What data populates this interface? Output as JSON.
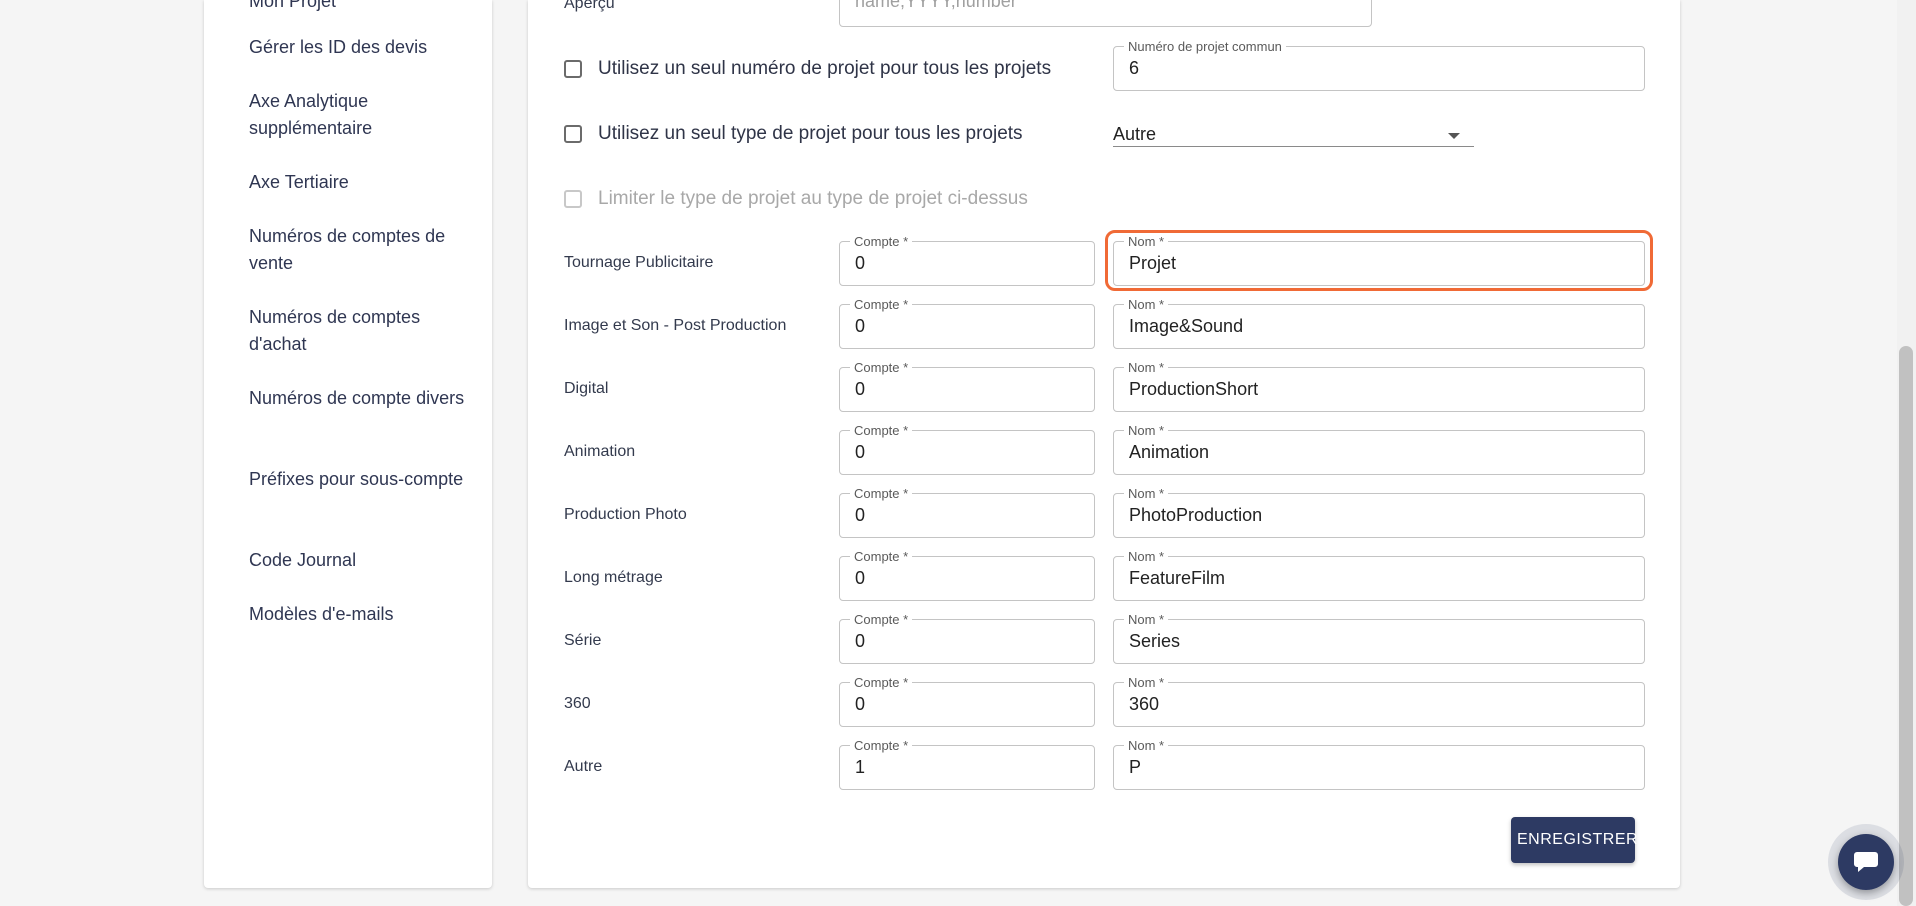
{
  "sidebar": {
    "items": [
      {
        "id": "partial",
        "label": "Mon Projet"
      },
      {
        "id": "quote-ids",
        "label": "Gérer les ID des devis"
      },
      {
        "id": "extra-axis",
        "label": "Axe Analytique supplémentaire"
      },
      {
        "id": "tertiary-axis",
        "label": "Axe Tertiaire"
      },
      {
        "id": "sales-accounts",
        "label": "Numéros de comptes de vente"
      },
      {
        "id": "purchase-accounts",
        "label": "Numéros de comptes d'achat"
      },
      {
        "id": "misc-accounts",
        "label": "Numéros de compte divers"
      },
      {
        "id": "subaccount-prefixes",
        "label": "Préfixes pour sous-compte"
      },
      {
        "id": "journal-code",
        "label": "Code Journal"
      },
      {
        "id": "email-templates",
        "label": "Modèles d'e-mails"
      }
    ]
  },
  "preview": {
    "label": "Aperçu",
    "placeholder": "name,YYYY,number"
  },
  "options": {
    "single_number": {
      "label": "Utilisez un seul numéro de projet pour tous les projets",
      "checked": false
    },
    "common_number": {
      "legend": "Numéro de projet commun",
      "value": "6"
    },
    "single_type": {
      "label": "Utilisez un seul type de projet pour tous les projets",
      "checked": false
    },
    "type_select": {
      "value": "Autre"
    },
    "limit_type": {
      "label": "Limiter le type de projet au type de projet ci-dessus",
      "checked": false,
      "disabled": true
    }
  },
  "field_legends": {
    "account": "Compte *",
    "name": "Nom *"
  },
  "project_types": [
    {
      "type": "Tournage Publicitaire",
      "account": "0",
      "name": "Projet"
    },
    {
      "type": "Image et Son - Post Production",
      "account": "0",
      "name": "Image&Sound"
    },
    {
      "type": "Digital",
      "account": "0",
      "name": "ProductionShort"
    },
    {
      "type": "Animation",
      "account": "0",
      "name": "Animation"
    },
    {
      "type": "Production Photo",
      "account": "0",
      "name": "PhotoProduction"
    },
    {
      "type": "Long métrage",
      "account": "0",
      "name": "FeatureFilm"
    },
    {
      "type": "Série",
      "account": "0",
      "name": "Series"
    },
    {
      "type": "360",
      "account": "0",
      "name": "360"
    },
    {
      "type": "Autre",
      "account": "1",
      "name": "P"
    }
  ],
  "save_button": {
    "label": "ENREGISTRER"
  },
  "chat": {
    "icon": "chat-bubble-icon",
    "color": "#2d3a63"
  },
  "colors": {
    "primary": "#2d3a63",
    "highlight": "#f06a36"
  }
}
